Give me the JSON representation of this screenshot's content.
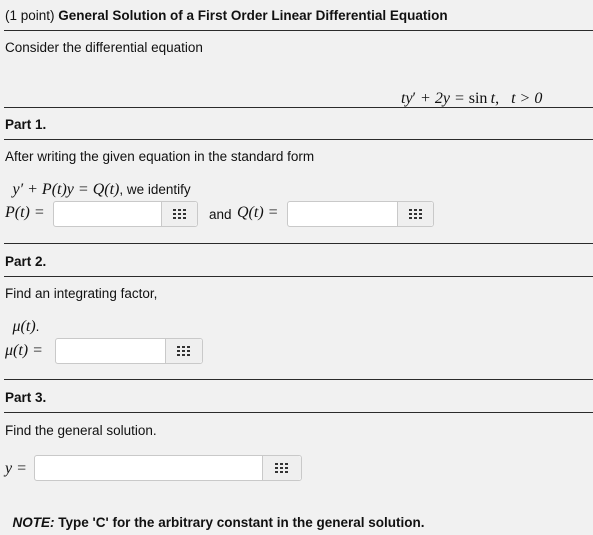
{
  "header": {
    "points": "(1 point)",
    "title": "General Solution of a First Order Linear Differential Equation"
  },
  "intro": "Consider the differential equation",
  "equation": {
    "lhs_t": "ty",
    "lhs_prime": "′",
    "lhs_rest": " + 2y = ",
    "sin": "sin",
    "sin_arg": "t",
    "sep": ",",
    "cond": "t > 0"
  },
  "part1": {
    "heading": "Part 1.",
    "text": "After writing the given equation in the standard form",
    "std_form_math": "y′ + P(t)y = Q(t)",
    "std_form_tail": ", we identify",
    "p_label": "P(t) =",
    "and": "and",
    "q_label": "Q(t) ="
  },
  "part2": {
    "heading": "Part 2.",
    "text": "Find an integrating factor,",
    "mu_math": "μ(t)",
    "mu_dot": ".",
    "mu_label": "μ(t) ="
  },
  "part3": {
    "heading": "Part 3.",
    "text": "Find the general solution.",
    "y_label": "y ="
  },
  "note": {
    "prefix": "NOTE:",
    "text": " Type 'C' for the arbitrary constant in the general solution."
  },
  "inputs": {
    "p_value": "",
    "q_value": "",
    "mu_value": "",
    "y_value": ""
  },
  "icons": {
    "equation_editor": "grid-icon"
  }
}
